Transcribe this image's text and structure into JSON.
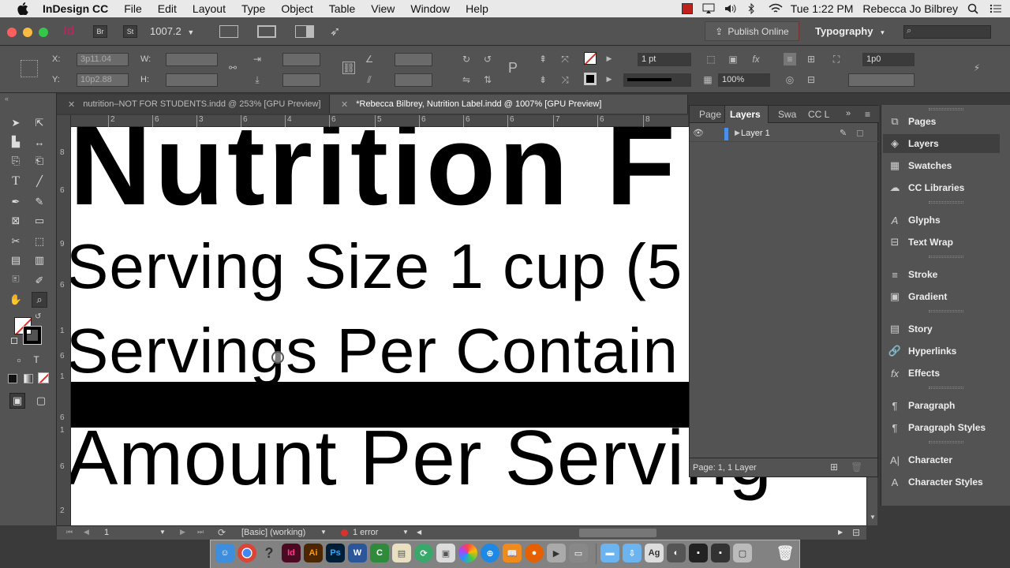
{
  "menubar": {
    "app_name": "InDesign CC",
    "items": [
      "File",
      "Edit",
      "Layout",
      "Type",
      "Object",
      "Table",
      "View",
      "Window",
      "Help"
    ],
    "clock": "Tue 1:22 PM",
    "user": "Rebecca Jo Bilbrey"
  },
  "appbar": {
    "zoom": "1007.2",
    "publish_label": "Publish Online",
    "workspace": "Typography",
    "bridge_label": "Br",
    "stock_label": "St"
  },
  "control": {
    "x_label": "X:",
    "y_label": "Y:",
    "w_label": "W:",
    "h_label": "H:",
    "x_value": "3p11.04",
    "y_value": "10p2.88",
    "stroke_weight": "1 pt",
    "gap_value": "1p0",
    "opacity": "100%"
  },
  "tabs": [
    {
      "label": "nutrition–NOT FOR STUDENTS.indd @ 253% [GPU Preview]"
    },
    {
      "label": "*Rebecca Bilbrey, Nutrition Label.indd @ 1007% [GPU Preview]"
    }
  ],
  "ruler_h": [
    "2",
    "6",
    "3",
    "6",
    "4",
    "6",
    "5",
    "6",
    "6",
    "6",
    "7",
    "6",
    "8"
  ],
  "ruler_v": [
    "8",
    "6",
    "9",
    "6",
    "1",
    "6",
    "1",
    "6",
    "1",
    "6",
    "2"
  ],
  "document": {
    "title": "Nutrition F",
    "line1": "Serving Size 1 cup (5",
    "line2": "Servings Per Contain",
    "line3": "Amount Per Serving"
  },
  "layers_panel": {
    "tabs": [
      "Page",
      "Layers",
      "Swa",
      "CC L"
    ],
    "layer_name": "Layer 1",
    "footer": "Page: 1, 1 Layer"
  },
  "dock": {
    "items": [
      "Pages",
      "Layers",
      "Swatches",
      "CC Libraries",
      "Glyphs",
      "Text Wrap",
      "Stroke",
      "Gradient",
      "Story",
      "Hyperlinks",
      "Effects",
      "Paragraph",
      "Paragraph Styles",
      "Character",
      "Character Styles"
    ]
  },
  "status": {
    "page": "1",
    "style": "[Basic] (working)",
    "errors": "1 error"
  },
  "colors": {
    "ui_dark": "#535353",
    "layer_blue": "#4a8fe8",
    "error_red": "#d6322e"
  }
}
